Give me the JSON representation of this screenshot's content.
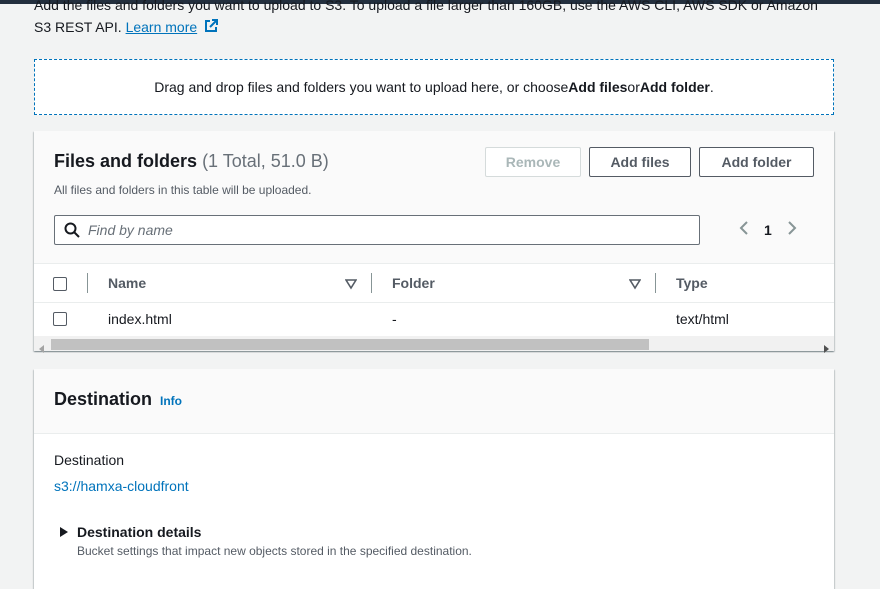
{
  "intro": {
    "line1": "Add the files and folders you want to upload to S3. To upload a file larger than 160GB, use the AWS CLI, AWS SDK or Amazon",
    "line2": "S3 REST API.",
    "learn_more": "Learn more"
  },
  "dropzone": {
    "text_pre": "Drag and drop files and folders you want to upload here, or choose ",
    "add_files": "Add files",
    "or": " or ",
    "add_folder": "Add folder",
    "end": "."
  },
  "files": {
    "title": "Files and folders",
    "count": "(1 Total, 51.0 B)",
    "description": "All files and folders in this table will be uploaded.",
    "remove_label": "Remove",
    "add_files_label": "Add files",
    "add_folder_label": "Add folder",
    "search_placeholder": "Find by name",
    "page": "1",
    "columns": {
      "name": "Name",
      "folder": "Folder",
      "type": "Type"
    },
    "rows": [
      {
        "name": "index.html",
        "folder": "-",
        "type": "text/html"
      }
    ]
  },
  "destination": {
    "title": "Destination",
    "info": "Info",
    "label": "Destination",
    "value": "s3://hamxa-cloudfront",
    "details_title": "Destination details",
    "details_desc": "Bucket settings that impact new objects stored in the specified destination."
  }
}
